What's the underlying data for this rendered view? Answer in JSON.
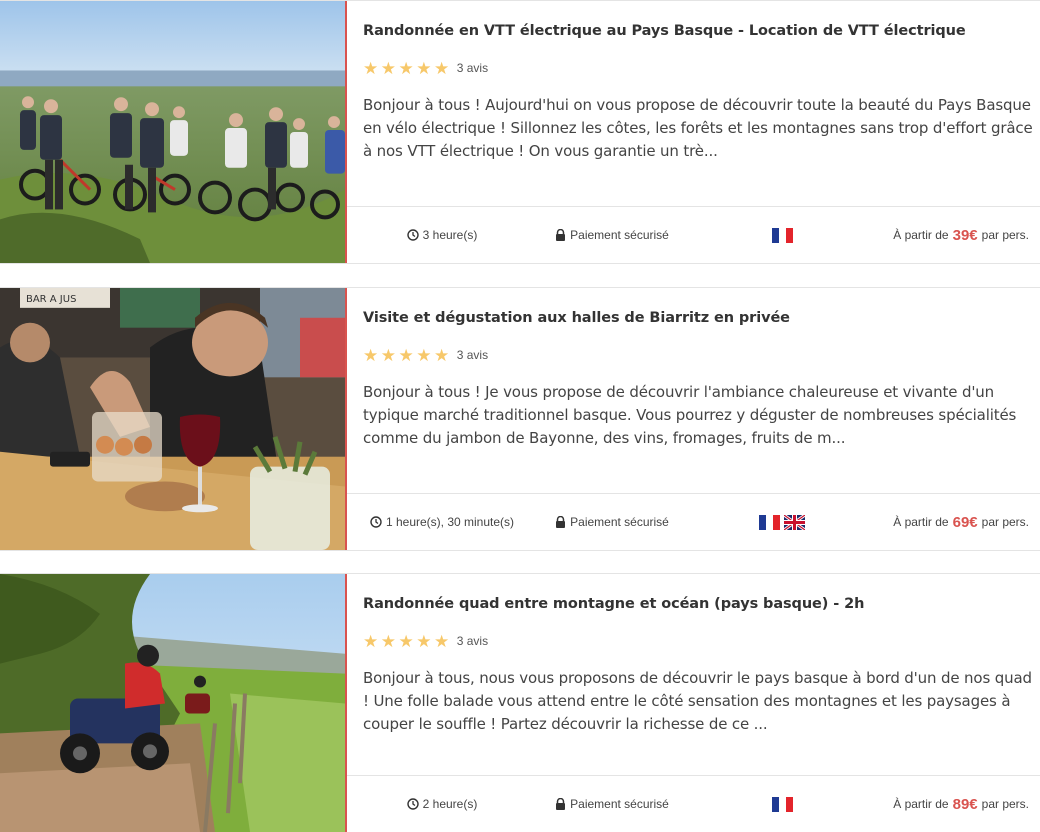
{
  "listings": [
    {
      "title": "Randonnée en VTT électrique au Pays Basque - Location de VTT électrique",
      "rating_stars": 5,
      "reviews": "3 avis",
      "description": "Bonjour à tous ! Aujourd'hui on vous propose de découvrir toute la beauté du Pays Basque en vélo électrique ! Sillonnez les côtes, les forêts et les montagnes sans trop d'effort grâce à nos VTT électrique ! On vous garantie un trè...",
      "duration": "3 heure(s)",
      "secure": "Paiement sécurisé",
      "languages": [
        "fr"
      ],
      "price_prefix": "À partir de",
      "price": "39€",
      "price_suffix": "par pers."
    },
    {
      "title": "Visite et dégustation aux halles de Biarritz en privée",
      "rating_stars": 5,
      "reviews": "3 avis",
      "description": "Bonjour à tous ! Je vous propose de découvrir l'ambiance chaleureuse et vivante d'un typique marché traditionnel basque. Vous pourrez y déguster de nombreuses spécialités comme du jambon de Bayonne, des vins, fromages, fruits de m...",
      "duration": "1 heure(s), 30 minute(s)",
      "secure": "Paiement sécurisé",
      "languages": [
        "fr",
        "gb"
      ],
      "price_prefix": "À partir de",
      "price": "69€",
      "price_suffix": "par pers."
    },
    {
      "title": "Randonnée quad entre montagne et océan (pays basque) - 2h",
      "rating_stars": 5,
      "reviews": "3 avis",
      "description": "Bonjour à tous, nous vous proposons de découvrir le pays basque à bord d'un de nos quad ! Une folle balade vous attend entre le côté sensation des montagnes et les paysages à couper le souffle ! Partez découvrir la richesse de ce ...",
      "duration": "2 heure(s)",
      "secure": "Paiement sécurisé",
      "languages": [
        "fr"
      ],
      "price_prefix": "À partir de",
      "price": "89€",
      "price_suffix": "par pers."
    }
  ],
  "photo_sign": "BAR A JUS",
  "colors": {
    "accent": "#d9534f",
    "star": "#f7c86a",
    "border": "#e4e4e4"
  }
}
